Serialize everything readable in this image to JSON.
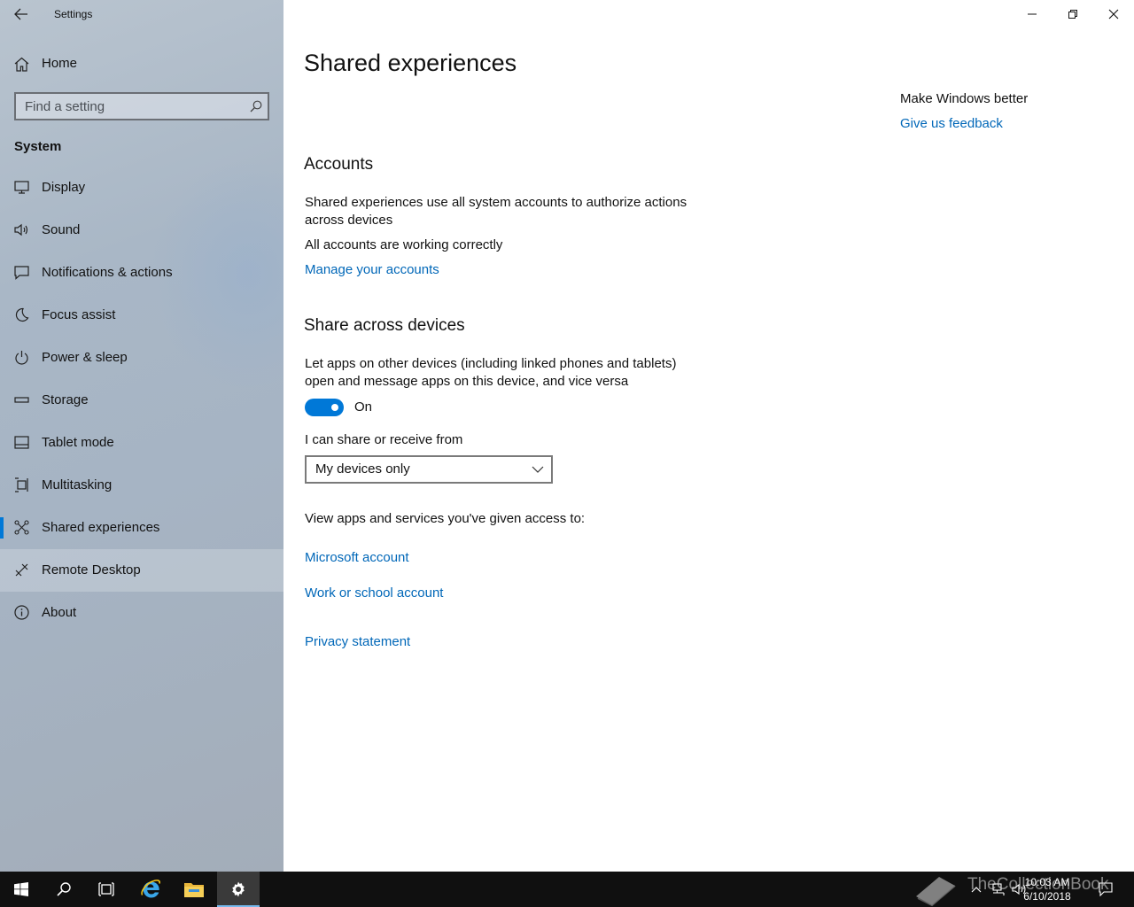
{
  "window": {
    "app_title": "Settings",
    "back_icon": "back-arrow-icon",
    "controls": [
      "minimize-icon",
      "restore-icon",
      "close-icon"
    ]
  },
  "sidebar": {
    "home_label": "Home",
    "search_placeholder": "Find a setting",
    "section_title": "System",
    "items": [
      {
        "label": "Display",
        "icon": "display-icon"
      },
      {
        "label": "Sound",
        "icon": "sound-icon"
      },
      {
        "label": "Notifications & actions",
        "icon": "notifications-icon"
      },
      {
        "label": "Focus assist",
        "icon": "focus-assist-icon"
      },
      {
        "label": "Power & sleep",
        "icon": "power-icon"
      },
      {
        "label": "Storage",
        "icon": "storage-icon"
      },
      {
        "label": "Tablet mode",
        "icon": "tablet-mode-icon"
      },
      {
        "label": "Multitasking",
        "icon": "multitasking-icon"
      },
      {
        "label": "Shared experiences",
        "icon": "shared-experiences-icon",
        "selected": true
      },
      {
        "label": "Remote Desktop",
        "icon": "remote-desktop-icon",
        "hover": true
      },
      {
        "label": "About",
        "icon": "info-icon"
      }
    ],
    "accent_color": "#0078d7"
  },
  "main": {
    "page_title": "Shared experiences",
    "accounts": {
      "heading": "Accounts",
      "description_line1": "Shared experiences use all system accounts to authorize actions",
      "description_line2": "across devices",
      "status": "All accounts are working correctly",
      "manage_link": "Manage your accounts"
    },
    "share": {
      "heading": "Share across devices",
      "description_line1": "Let apps on other devices (including linked phones and tablets)",
      "description_line2": "open and message apps on this device, and vice versa",
      "toggle_state": "On",
      "toggle_on": true,
      "dropdown_label": "I can share or receive from",
      "dropdown_value": "My devices only",
      "access_label": "View apps and services you've given access to:",
      "microsoft_account_link": "Microsoft account",
      "work_account_link": "Work or school account",
      "privacy_link": "Privacy statement"
    },
    "right_column": {
      "title": "Make Windows better",
      "feedback_link": "Give us feedback"
    },
    "link_color": "#0067b8"
  },
  "taskbar": {
    "buttons": [
      "windows-start-icon",
      "search-icon",
      "task-view-icon",
      "internet-explorer-icon",
      "file-explorer-icon",
      "settings-gear-icon"
    ],
    "active": "settings-gear-icon",
    "clock_time": "10:03 AM",
    "clock_date": "6/10/2018",
    "watermark": "TheCollectionBook"
  }
}
